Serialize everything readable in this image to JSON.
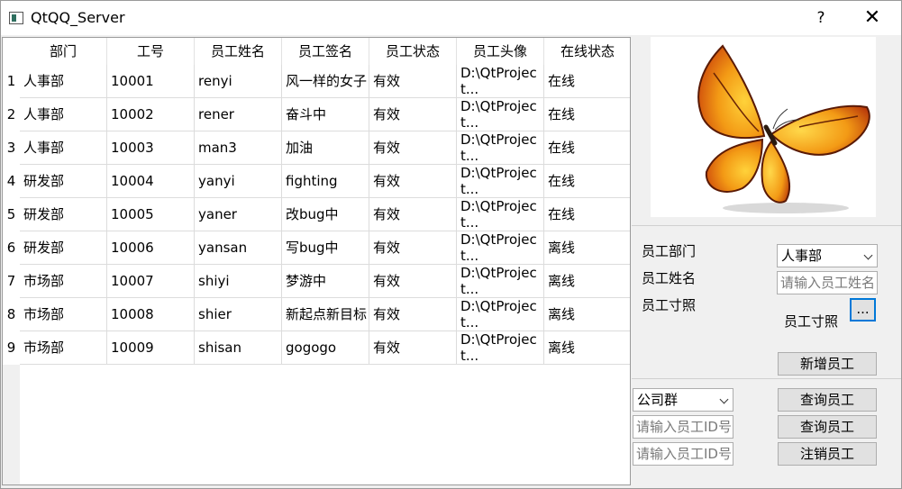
{
  "window": {
    "title": "QtQQ_Server",
    "help_glyph": "?",
    "close_glyph": "✕"
  },
  "table": {
    "columns": [
      "部门",
      "工号",
      "员工姓名",
      "员工签名",
      "员工状态",
      "员工头像",
      "在线状态"
    ],
    "row_numbers": [
      "1",
      "2",
      "3",
      "4",
      "5",
      "6",
      "7",
      "8",
      "9"
    ],
    "rows": [
      [
        "人事部",
        "10001",
        "renyi",
        "风一样的女子",
        "有效",
        "D:\\QtProject...",
        "在线"
      ],
      [
        "人事部",
        "10002",
        "rener",
        "奋斗中",
        "有效",
        "D:\\QtProject...",
        "在线"
      ],
      [
        "人事部",
        "10003",
        "man3",
        "加油",
        "有效",
        "D:\\QtProject...",
        "在线"
      ],
      [
        "研发部",
        "10004",
        "yanyi",
        "fighting",
        "有效",
        "D:\\QtProject...",
        "在线"
      ],
      [
        "研发部",
        "10005",
        "yaner",
        "改bug中",
        "有效",
        "D:\\QtProject...",
        "在线"
      ],
      [
        "研发部",
        "10006",
        "yansan",
        "写bug中",
        "有效",
        "D:\\QtProject...",
        "离线"
      ],
      [
        "市场部",
        "10007",
        "shiyi",
        "梦游中",
        "有效",
        "D:\\QtProject...",
        "离线"
      ],
      [
        "市场部",
        "10008",
        "shier",
        "新起点新目标",
        "有效",
        "D:\\QtProject...",
        "离线"
      ],
      [
        "市场部",
        "10009",
        "shisan",
        "gogogo",
        "有效",
        "D:\\QtProject...",
        "离线"
      ]
    ]
  },
  "add_form": {
    "dept_label": "员工部门",
    "name_label": "员工姓名",
    "photo_label": "员工寸照",
    "dept_selected": "人事部",
    "name_placeholder": "请输入员工姓名",
    "photo_caption": "员工寸照",
    "browse_label": "...",
    "add_button": "新增员工"
  },
  "query_form": {
    "group_selected": "公司群",
    "id_placeholder_1": "请输入员工ID号",
    "id_placeholder_2": "请输入员工ID号",
    "query_button_1": "查询员工",
    "query_button_2": "查询员工",
    "logout_button": "注销员工"
  }
}
